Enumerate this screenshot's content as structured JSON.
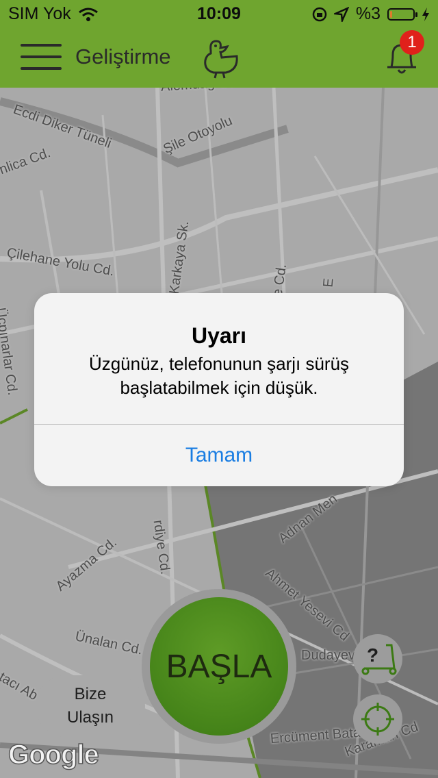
{
  "status_bar": {
    "carrier": "SIM Yok",
    "time": "10:09",
    "battery_percent": "%3",
    "battery_level": 0.03
  },
  "app_bar": {
    "title": "Geliştirme",
    "notification_count": "1"
  },
  "map": {
    "street_labels": [
      "Alemdağ Cd.",
      "Ecdi Diker Tüneli",
      "Şile Otoyolu",
      "nlica Cd.",
      "Çilehane Yolu Cd.",
      "Karkaya Sk.",
      "re Cd.",
      "E",
      "Üçpınarlar Cd.",
      "Adnan Men",
      "rdiye Cd.",
      "Ayazma Cd.",
      "Ahmet Yesevi Cd",
      "Ünalan Cd.",
      "Dudayev",
      "tacı Ab",
      "Ercüment Bata",
      "Karaman Cd"
    ],
    "attribution": "Google"
  },
  "alert": {
    "title": "Uyarı",
    "message": "Üzgünüz, telefonunun şarjı sürüş başlatabilmek için düşük.",
    "button_label": "Tamam"
  },
  "controls": {
    "start_label": "BAŞLA",
    "contact_line1": "Bize",
    "contact_line2": "Ulaşın",
    "help_icon": "scooter-help-icon",
    "locate_icon": "crosshair-icon"
  },
  "colors": {
    "brand_green": "#6fa52f",
    "start_green": "#3b7a14",
    "alert_button_blue": "#1a7de2",
    "badge_red": "#e0211b"
  }
}
